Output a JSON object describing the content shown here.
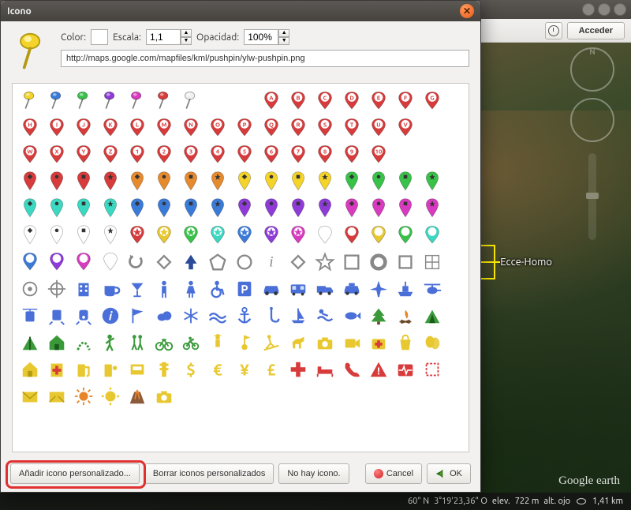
{
  "app_bar": {
    "title": ""
  },
  "toolbar": {
    "access_label": "Acceder"
  },
  "dialog": {
    "title": "Icono",
    "color_label": "Color:",
    "scale_label": "Escala:",
    "scale_value": "1,1",
    "opacity_label": "Opacidad:",
    "opacity_value": "100%",
    "url_value": "http://maps.google.com/mapfiles/kml/pushpin/ylw-pushpin.png",
    "buttons": {
      "add_custom": "Añadir icono personalizado...",
      "clear_custom": "Borrar iconos personalizados",
      "no_icon": "No hay icono.",
      "cancel": "Cancel",
      "ok": "OK"
    }
  },
  "placemark": {
    "label": "Ecce-Homo"
  },
  "status": {
    "lat": "60\" N",
    "lon": "3°19'23,36\" O",
    "elev_label": "elev.",
    "elev_value": "722 m",
    "alt_label": "alt. ojo",
    "alt_value": "1,41 km"
  },
  "ge_logo": "Google earth",
  "icons": {
    "pushpin_colors": [
      "#f4d42a",
      "#3b7bd8",
      "#39c24a",
      "#8e3bd8",
      "#d83bbf",
      "#d83b3b",
      "#f0f0f0"
    ],
    "paddle_letters_row1": [
      "A",
      "B",
      "C",
      "D",
      "E",
      "F",
      "G"
    ],
    "paddle_letters_row2": [
      "H",
      "I",
      "J",
      "K",
      "L",
      "M",
      "N",
      "O",
      "P",
      "Q",
      "R",
      "S",
      "T",
      "U",
      "V"
    ],
    "paddle_letters_row3": [
      "W",
      "X",
      "Y",
      "Z",
      "1",
      "2",
      "3",
      "4",
      "5",
      "6",
      "7",
      "8",
      "9",
      "10"
    ],
    "paddle_shapes": [
      "diamond",
      "circle",
      "square",
      "star",
      "blank"
    ],
    "pin_colors": [
      "#d83b3b",
      "#e68a2e",
      "#f4d42a",
      "#39c24a",
      "#3bd8c2",
      "#3b7bd8",
      "#8e3bd8",
      "#d83bbf",
      "#ffffff"
    ],
    "misc_icons": [
      "undo",
      "open-diamond",
      "arrow",
      "polygon",
      "circle-outline",
      "info-italic",
      "diamond-outline",
      "star-outline",
      "stop-outline",
      "donut",
      "square-outline",
      "grid",
      "target",
      "crosshair",
      "building",
      "coffee",
      "cocktail",
      "restroom-m",
      "restroom-w",
      "wheelchair",
      "parking",
      "car",
      "bus",
      "truck",
      "taxi",
      "plane",
      "ship",
      "heli",
      "tram",
      "rail",
      "train",
      "info-circle",
      "flag",
      "cloud",
      "snow",
      "water-waves",
      "anchor",
      "hook",
      "sailboat",
      "swim",
      "fish",
      "tree",
      "campfire",
      "tent-a",
      "tent",
      "house",
      "trail",
      "hiker",
      "hikers",
      "bike",
      "motorbike",
      "ranger",
      "golf",
      "ski",
      "horse",
      "camera-y",
      "film",
      "firstaid",
      "shopping",
      "masks",
      "home-y",
      "hospital",
      "gas",
      "gas2",
      "atm",
      "tower",
      "dollar",
      "euro",
      "yen",
      "pound",
      "plus-red",
      "bed",
      "phone",
      "warning",
      "heart-ecg",
      "square-dash",
      "mail",
      "mail2",
      "sun",
      "sun2",
      "volcano",
      "camera2"
    ]
  }
}
